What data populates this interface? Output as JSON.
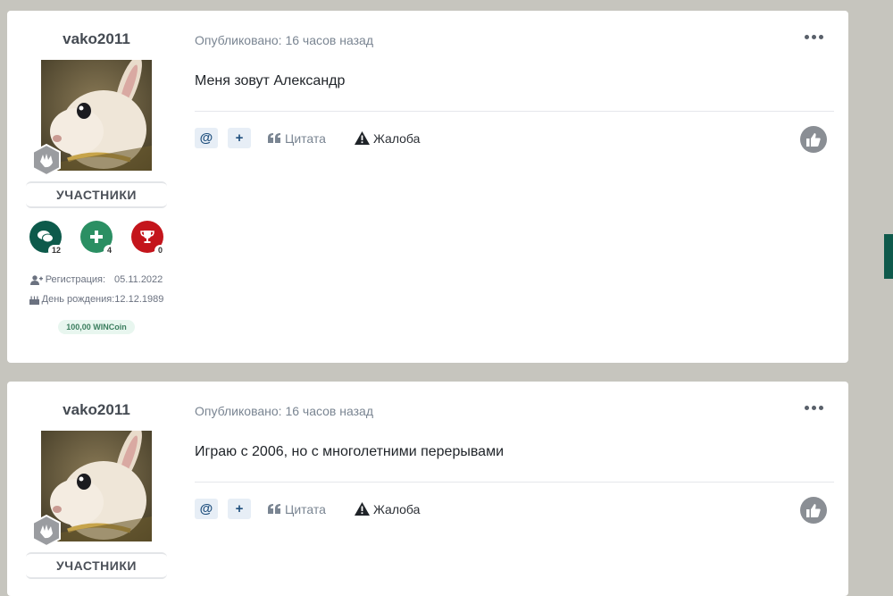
{
  "posts": [
    {
      "author": "vako2011",
      "group": "УЧАСТНИКИ",
      "stats": [
        {
          "icon": "chat-icon",
          "count": "12",
          "color": "#0d5a4b"
        },
        {
          "icon": "plus-icon",
          "count": "4",
          "color": "#2b8f63"
        },
        {
          "icon": "trophy-icon",
          "count": "0",
          "color": "#c4151c"
        }
      ],
      "registration_label": "Регистрация:",
      "registration_date": "05.11.2022",
      "birthday_label": "День рождения:",
      "birthday_date": "12.12.1989",
      "coins": "100,00 WINCoin",
      "meta": "Опубликовано: 16 часов назад",
      "text": "Меня зовут Александр",
      "quote_label": "Цитата",
      "report_label": "Жалоба"
    },
    {
      "author": "vako2011",
      "group": "УЧАСТНИКИ",
      "meta": "Опубликовано: 16 часов назад",
      "text": "Играю с 2006, но с многолетними перерывами",
      "quote_label": "Цитата",
      "report_label": "Жалоба"
    }
  ],
  "actions": {
    "mention": "@",
    "multiquote": "+"
  },
  "colors": {
    "background": "#c6c5be",
    "accent": "#0f5a4c"
  }
}
